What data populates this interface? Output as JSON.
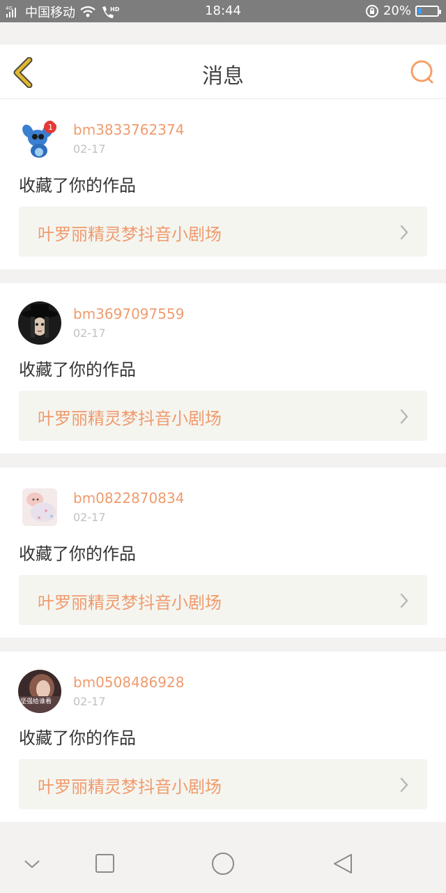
{
  "status_bar": {
    "carrier": "中国移动",
    "network": "4G",
    "hd": "HD",
    "time": "18:44",
    "battery_percent": "20%",
    "battery_level": 0.2
  },
  "header": {
    "title": "消息"
  },
  "colors": {
    "accent": "#ef9b6d",
    "back_arrow": "#e0b830",
    "card_link_bg": "#f5f5f0"
  },
  "messages": [
    {
      "username": "bm3833762374",
      "date": "02-17",
      "action": "收藏了你的作品",
      "work_title": "叶罗丽精灵梦抖音小剧场",
      "avatar": "stitch-avatar"
    },
    {
      "username": "bm3697097559",
      "date": "02-17",
      "action": "收藏了你的作品",
      "work_title": "叶罗丽精灵梦抖音小剧场",
      "avatar": "dark-hat-avatar"
    },
    {
      "username": "bm0822870834",
      "date": "02-17",
      "action": "收藏了你的作品",
      "work_title": "叶罗丽精灵梦抖音小剧场",
      "avatar": "baby-avatar"
    },
    {
      "username": "bm0508486928",
      "date": "02-17",
      "action": "收藏了你的作品",
      "work_title": "叶罗丽精灵梦抖音小剧场",
      "avatar": "girl-avatar",
      "avatar_text": "坚强给谁看"
    }
  ],
  "nav_bar": {
    "icons": [
      "chevron-down-icon",
      "square-icon",
      "circle-icon",
      "triangle-back-icon"
    ]
  }
}
